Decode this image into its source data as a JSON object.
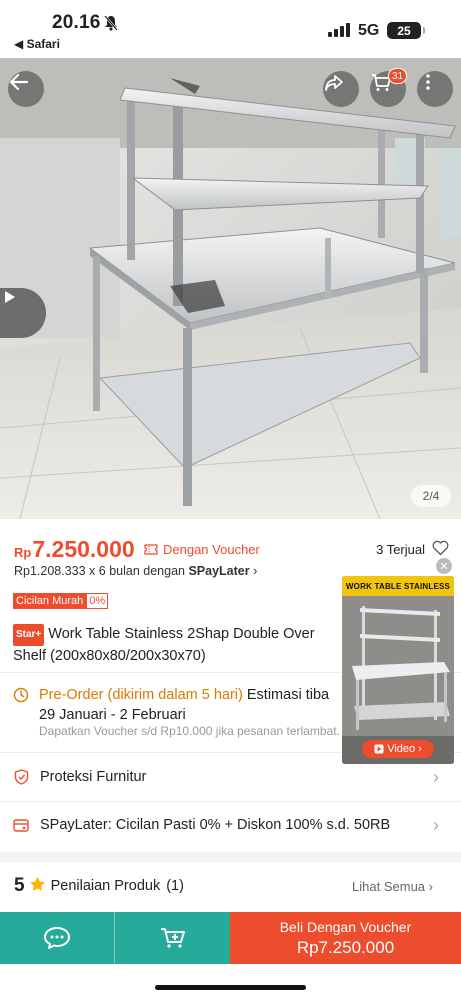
{
  "status_bar": {
    "time": "20.16",
    "back_app": "Safari",
    "network": "5G",
    "battery": "25"
  },
  "hero": {
    "image_counter": "2/4",
    "cart_count": "31"
  },
  "price": {
    "currency": "Rp",
    "amount": "7.250.000",
    "voucher_label": "Dengan Voucher",
    "sold": "3 Terjual",
    "installment_text": "Rp1.208.333 x 6 bulan dengan ",
    "installment_brand": "SPayLater",
    "cicilan_label": "Cicilan Murah",
    "cicilan_rate": "0%"
  },
  "product": {
    "tag": "Star+",
    "title": "Work Table Stainless 2Shap Double Over Shelf (200x80x80/200x30x70)"
  },
  "preorder": {
    "label": "Pre-Order (dikirim dalam 5 hari)",
    "estimate": " Estimasi tiba 29 Januari - 2 Februari",
    "voucher_note": "Dapatkan Voucher s/d Rp10.000 jika pesanan terlambat."
  },
  "rows": {
    "protection": "Proteksi Furnitur",
    "spaylater": "SPayLater: Cicilan Pasti 0% + Diskon 100% s.d. 50RB"
  },
  "rating": {
    "score": "5",
    "label": "Penilaian Produk",
    "count": "(1)",
    "see_all": "Lihat Semua"
  },
  "float_video": {
    "banner": "WORK TABLE STAINLESS",
    "button": "Video"
  },
  "bottom_bar": {
    "buy_label": "Beli Dengan Voucher",
    "buy_price": "Rp7.250.000"
  },
  "colors": {
    "accent": "#ee4d2d",
    "teal": "#26aa99",
    "preorder": "#d97a00"
  }
}
